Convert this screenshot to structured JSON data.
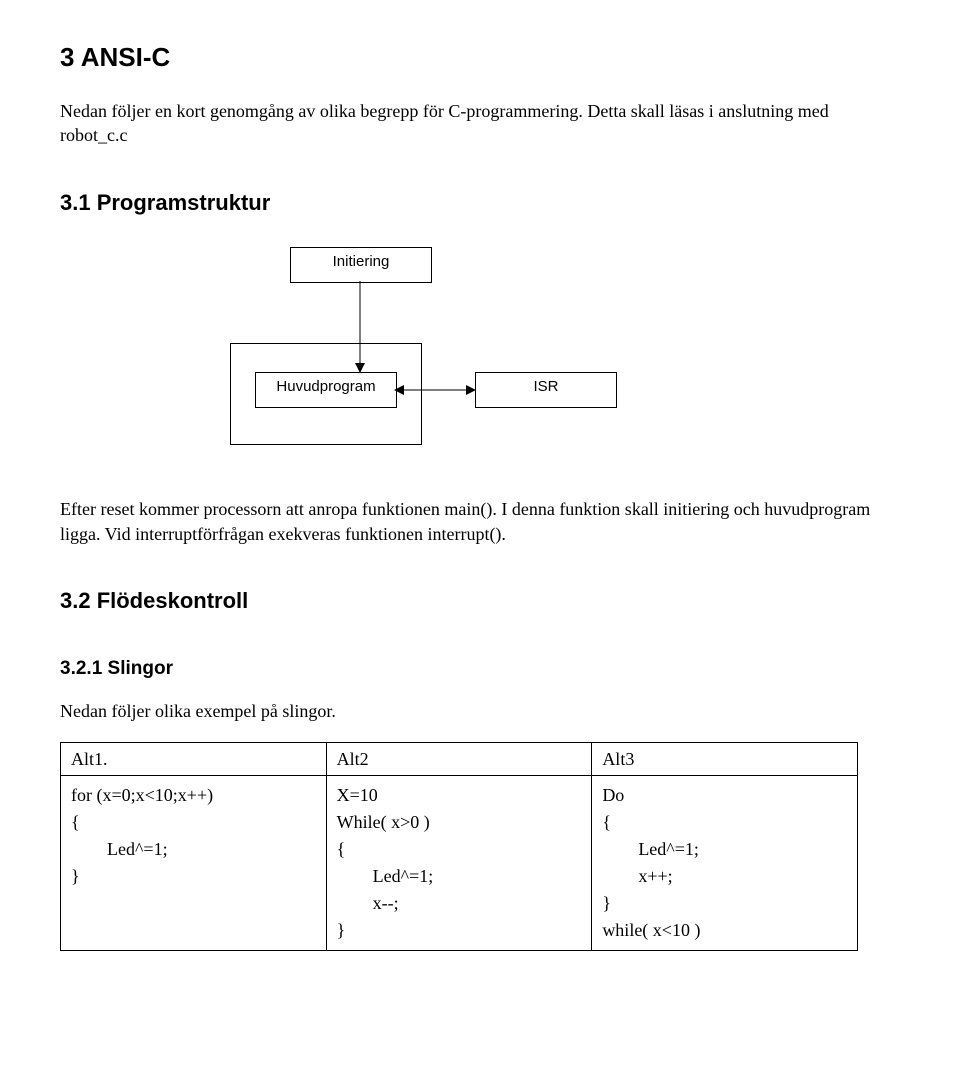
{
  "section3": {
    "title": "3   ANSI-C",
    "intro": "Nedan följer en kort genomgång av olika begrepp för C-programmering. Detta skall läsas i anslutning med robot_c.c"
  },
  "section31": {
    "title": "3.1  Programstruktur",
    "diagram": {
      "init": "Initiering",
      "huvud": "Huvudprogram",
      "isr": "ISR"
    },
    "after": "Efter reset kommer processorn att anropa funktionen main(). I denna funktion skall initiering och huvudprogram ligga. Vid interruptförfrågan exekveras funktionen interrupt()."
  },
  "section32": {
    "title": "3.2  Flödeskontroll"
  },
  "section321": {
    "title": "3.2.1  Slingor",
    "intro": "Nedan följer olika exempel på slingor.",
    "headers": {
      "c1": "Alt1.",
      "c2": "Alt2",
      "c3": "Alt3"
    },
    "code": {
      "c1": "for (x=0;x<10;x++)\n{\n        Led^=1;\n}",
      "c2": "X=10\nWhile( x>0 )\n{\n        Led^=1;\n        x--;\n}",
      "c3": "Do\n{\n        Led^=1;\n        x++;\n}\nwhile( x<10 )"
    }
  }
}
